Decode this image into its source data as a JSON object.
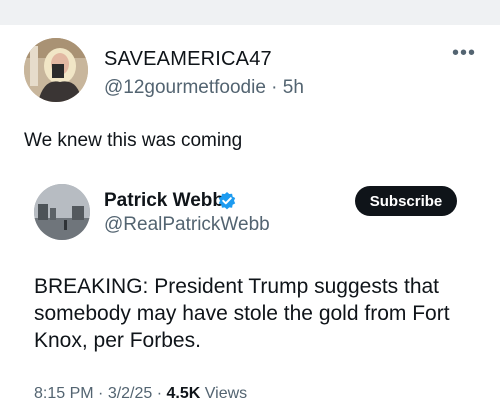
{
  "tweet": {
    "display_name": "SAVEAMERICA47",
    "handle": "@12gourmetfoodie",
    "separator": "·",
    "age": "5h",
    "more_icon": "more-horizontal-icon",
    "text": "We knew this was coming"
  },
  "quoted": {
    "display_name": "Patrick Webb",
    "handle": "@RealPatrickWebb",
    "verified_color": "#1d9bf0",
    "subscribe_label": "Subscribe",
    "text": "BREAKING: President Trump suggests that somebody may have stole the gold from Fort Knox, per Forbes.",
    "time": "8:15 PM",
    "date": "3/2/25",
    "views_count": "4.5K",
    "views_label": "Views"
  }
}
